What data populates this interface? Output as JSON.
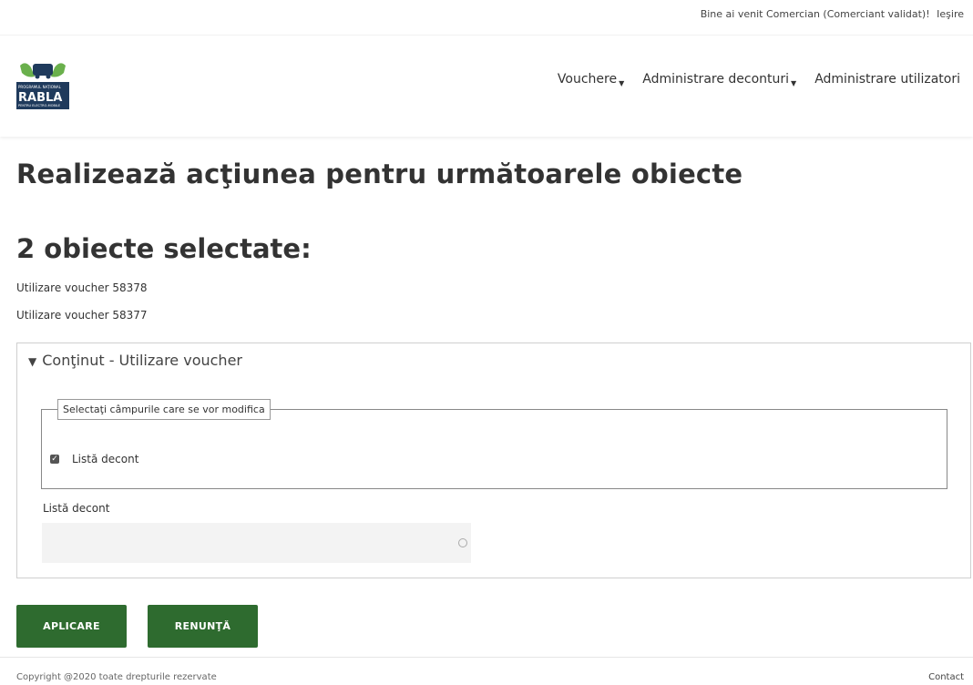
{
  "topbar": {
    "welcome": "Bine ai venit Comercian (Comerciant validat)!",
    "logout": "Ieşire"
  },
  "logo": {
    "line1": "PROGRAMUL NAȚIONAL",
    "brand": "RABLA",
    "line2": "PENTRU ELECTRO-MOBILE",
    "accent_color": "#6ab04c",
    "brand_color": "#1f3a5c"
  },
  "nav": {
    "items": [
      {
        "label": "Vouchere",
        "has_dropdown": true
      },
      {
        "label": "Administrare deconturi",
        "has_dropdown": true
      },
      {
        "label": "Administrare utilizatori",
        "has_dropdown": false
      }
    ]
  },
  "page": {
    "title": "Realizează acţiunea pentru următoarele obiecte",
    "count_title": "2 obiecte selectate:",
    "objects": [
      "Utilizare voucher 58378",
      "Utilizare voucher 58377"
    ]
  },
  "panel": {
    "summary": "Conţinut - Utilizare voucher",
    "legend": "Selectaţi câmpurile care se vor modifica",
    "checkbox_label": "Listă decont",
    "checkbox_checked": true,
    "field_label": "Listă decont",
    "select_value": ""
  },
  "buttons": {
    "apply": "APLICARE",
    "cancel": "RENUNŢĂ",
    "color": "#2e6b2f"
  },
  "footer": {
    "copyright": "Copyright @2020 toate drepturile rezervate",
    "contact": "Contact"
  }
}
